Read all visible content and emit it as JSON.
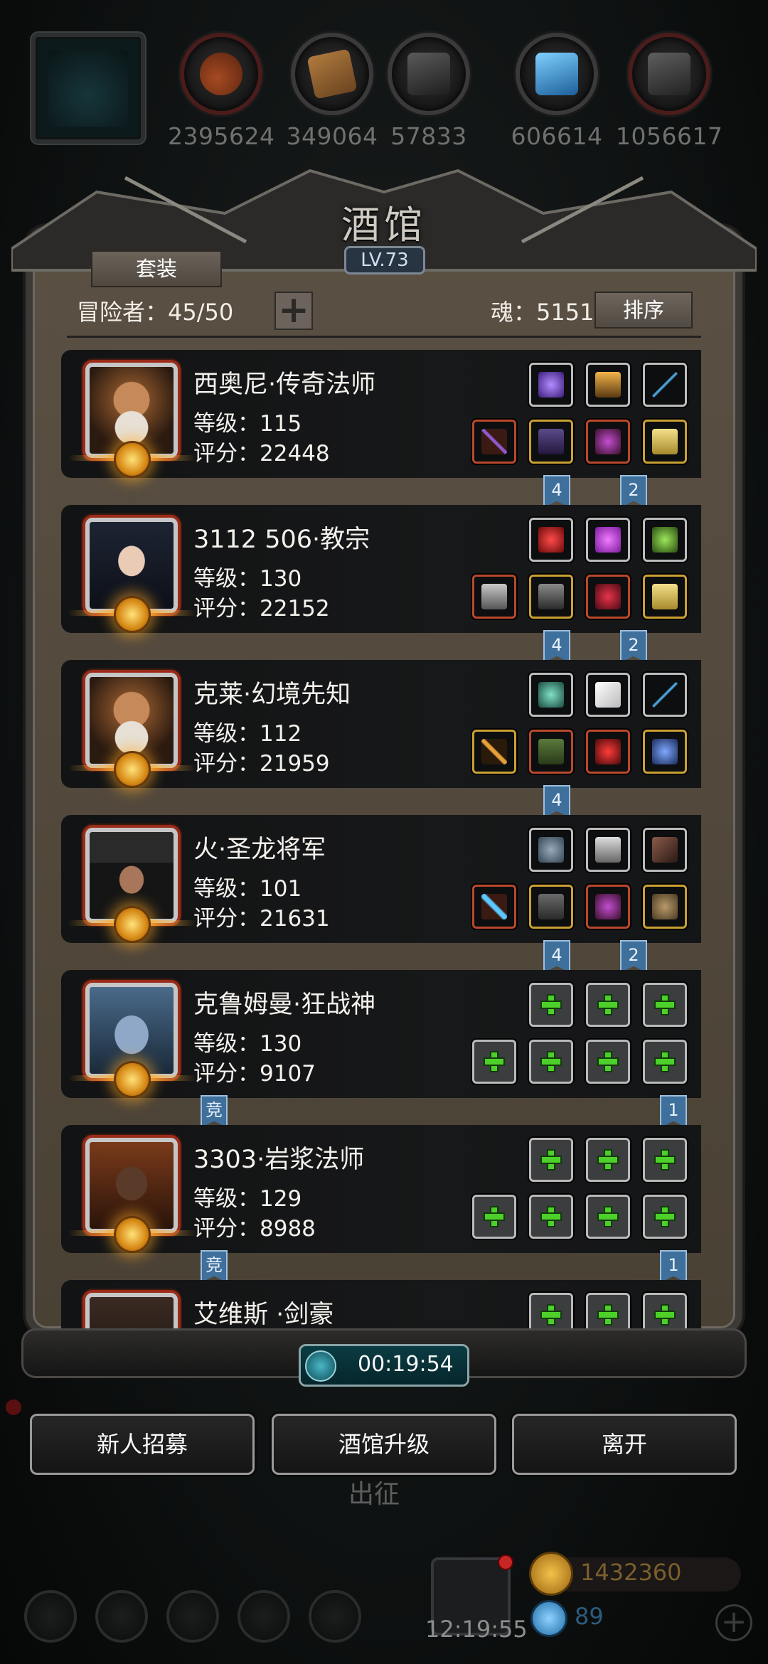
{
  "resources": [
    {
      "name": "meat-icon",
      "value": "2395624",
      "color": "#8a3c1c"
    },
    {
      "name": "wood-icon",
      "value": "349064",
      "color": "#8a5a2a"
    },
    {
      "name": "iron-icon",
      "value": "57833",
      "color": "#3a3a3a"
    },
    {
      "name": "crystal-icon",
      "value": "606614",
      "color": "#2a7fc0"
    },
    {
      "name": "ore-icon",
      "value": "1056617",
      "color": "#444444"
    }
  ],
  "tavern": {
    "title": "酒馆",
    "level": "LV.73",
    "outfit_button": "套装",
    "adventurers": "冒险者：45/50",
    "soul": "魂：5151",
    "sort_button": "排序"
  },
  "heroes": [
    {
      "name": "西奥尼·传奇法师",
      "level": "等级：115",
      "score": "评分：22448",
      "empty": false,
      "top_slots": [
        "purple-orb",
        "torch",
        "spear"
      ],
      "bottom_slots": [
        "staff",
        "robe",
        "amulet",
        "gauntlet"
      ],
      "tags": [
        "4",
        "2"
      ]
    },
    {
      "name": "3112  506·教宗",
      "level": "等级：130",
      "score": "评分：22152",
      "empty": false,
      "top_slots": [
        "red-orb",
        "purple-gem",
        "lantern"
      ],
      "bottom_slots": [
        "hammer",
        "armor",
        "potion",
        "gauntlet"
      ],
      "tags": [
        "4",
        "2"
      ]
    },
    {
      "name": "克莱·幻境先知",
      "level": "等级：112",
      "score": "评分：21959",
      "empty": false,
      "top_slots": [
        "green-rune",
        "feather",
        "spear"
      ],
      "bottom_slots": [
        "scepter",
        "armor",
        "red-eye",
        "pendant"
      ],
      "tags": [
        "4"
      ]
    },
    {
      "name": "火·圣龙将军",
      "level": "等级：101",
      "score": "评分：21631",
      "empty": false,
      "top_slots": [
        "stone",
        "crest",
        "claw"
      ],
      "bottom_slots": [
        "ice-blade",
        "armor",
        "amulet",
        "beast"
      ],
      "tags": [
        "4",
        "2"
      ]
    },
    {
      "name": "克鲁姆曼·狂战神",
      "level": "等级：130",
      "score": "评分：9107",
      "empty": true,
      "tags_left": "竞",
      "tags_right": "1"
    },
    {
      "name": "3303·岩浆法师",
      "level": "等级：129",
      "score": "评分：8988",
      "empty": true,
      "tags_left": "竞",
      "tags_right": "1"
    },
    {
      "name": "艾维斯 ·剑豪",
      "level": "",
      "score": "",
      "empty": true
    }
  ],
  "timer": "00:19:54",
  "actions": {
    "recruit": "新人招募",
    "upgrade": "酒馆升级",
    "leave": "离开"
  },
  "go_label": "出征",
  "bottom": {
    "time": "12:19:55",
    "gold": "1432360",
    "gems": "89"
  }
}
